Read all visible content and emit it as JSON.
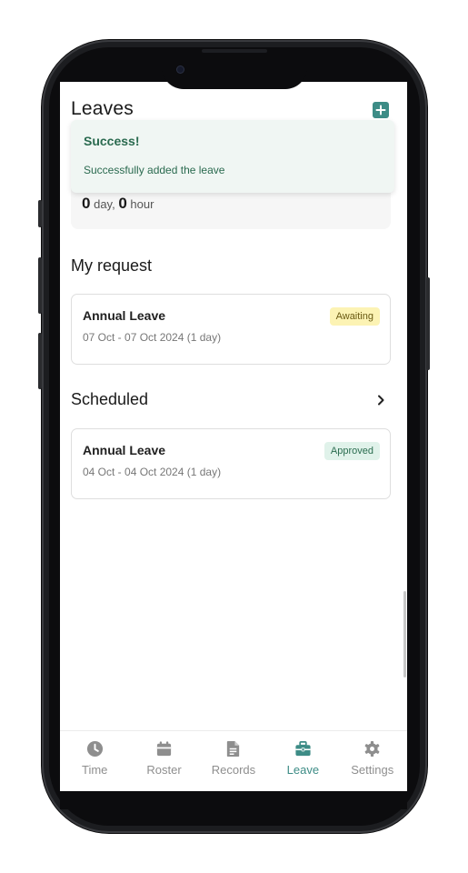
{
  "header": {
    "title": "Leaves"
  },
  "toast": {
    "title": "Success!",
    "message": "Successfully added the leave"
  },
  "balance": {
    "days": "0",
    "day_unit": "day,",
    "hours": "0",
    "hour_unit": "hour"
  },
  "my_request": {
    "title": "My request",
    "items": [
      {
        "type": "Annual Leave",
        "dates": "07 Oct - 07 Oct 2024 (1 day)",
        "status": "Awaiting"
      }
    ]
  },
  "scheduled": {
    "title": "Scheduled",
    "items": [
      {
        "type": "Annual Leave",
        "dates": "04 Oct - 04 Oct 2024 (1 day)",
        "status": "Approved"
      }
    ]
  },
  "tabbar": {
    "active": "Leave",
    "items": [
      {
        "label": "Time",
        "icon": "clock-icon"
      },
      {
        "label": "Roster",
        "icon": "calendar-icon"
      },
      {
        "label": "Records",
        "icon": "document-icon"
      },
      {
        "label": "Leave",
        "icon": "briefcase-icon"
      },
      {
        "label": "Settings",
        "icon": "gear-icon"
      }
    ]
  },
  "colors": {
    "accent": "#3d8c86",
    "awaiting_bg": "#fcf3b4",
    "approved_bg": "#e0f2ea",
    "toast_text": "#2a6a4f"
  }
}
